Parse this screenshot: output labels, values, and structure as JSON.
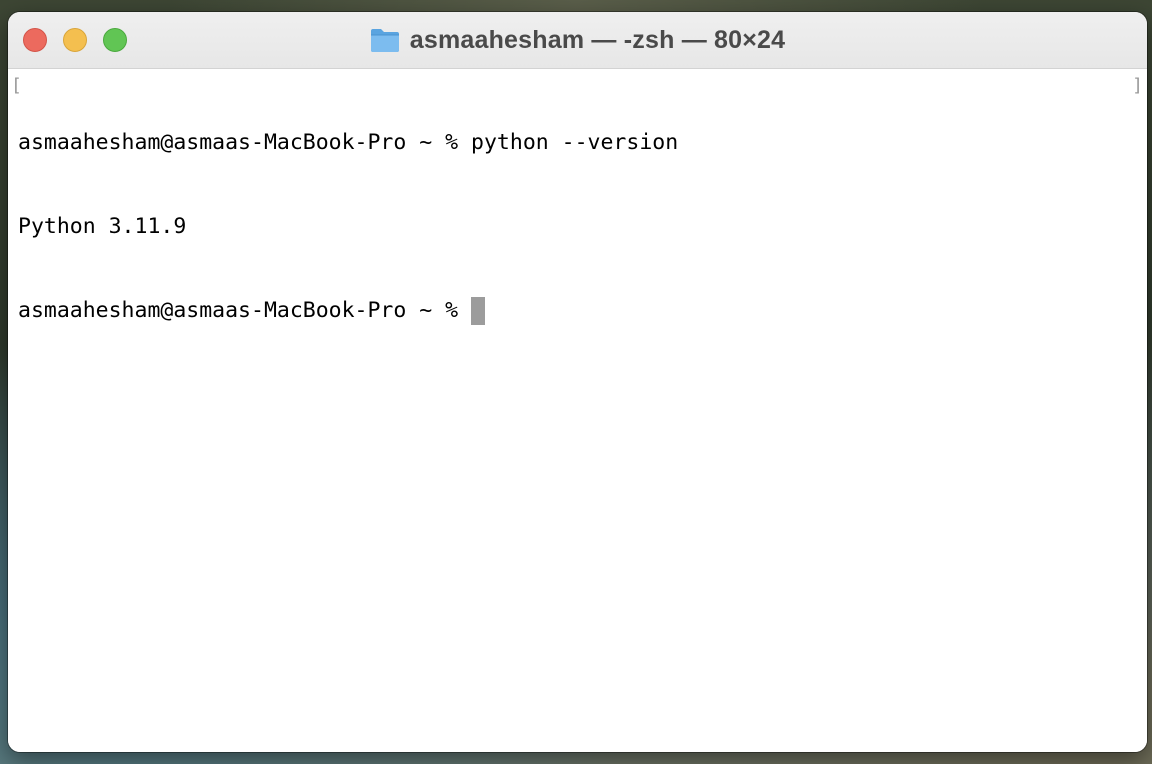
{
  "window": {
    "title": "asmaahesham — -zsh — 80×24",
    "title_icon": "folder-icon",
    "controls": {
      "close_color": "#ec6a5e",
      "minimize_color": "#f4bf4f",
      "zoom_color": "#61c554"
    }
  },
  "terminal": {
    "lines": [
      "asmaahesham@asmaas-MacBook-Pro ~ % python --version",
      "Python 3.11.9",
      "asmaahesham@asmaas-MacBook-Pro ~ % "
    ],
    "mark_left": "[",
    "mark_right": "]",
    "cursor_color": "#9c9c9c"
  }
}
